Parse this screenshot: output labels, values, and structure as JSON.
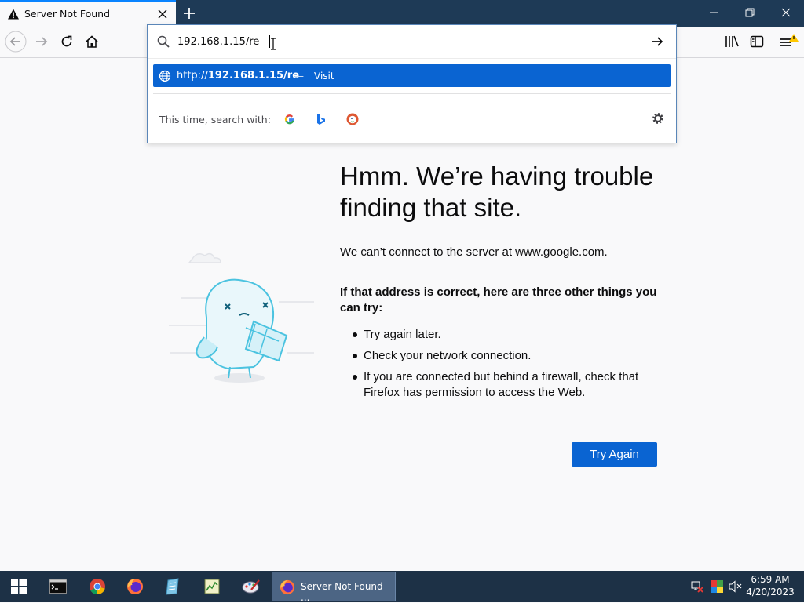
{
  "tab": {
    "title": "Server Not Found"
  },
  "urlbar": {
    "value": "192.168.1.15/re",
    "suggestion": {
      "prefix": "http://",
      "host": "192.168.1.15/re",
      "separator": "—",
      "action": "Visit"
    },
    "oneoff_label": "This time, search with:",
    "engines": [
      "google-icon",
      "bing-icon",
      "duckduckgo-icon"
    ]
  },
  "error": {
    "title": "Hmm. We’re having trouble finding that site.",
    "description": "We can’t connect to the server at www.google.com.",
    "try_heading": "If that address is correct, here are three other things you can try:",
    "tips": [
      "Try again later.",
      "Check your network connection.",
      "If you are connected but behind a firewall, check that Firefox has permission to access the Web."
    ],
    "button": "Try Again"
  },
  "taskbar": {
    "active_task": "Server Not Found - ...",
    "time": "6:59 AM",
    "date": "4/20/2023"
  },
  "colors": {
    "accent": "#0a64d2",
    "titlebar": "#1e3a56",
    "taskbar": "#1d3146"
  }
}
